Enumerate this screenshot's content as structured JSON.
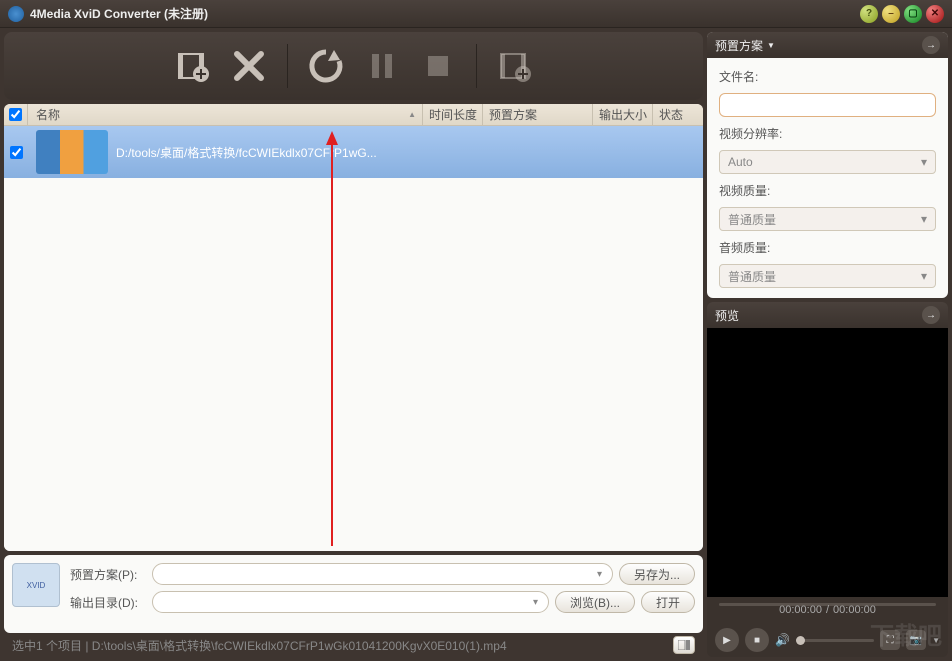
{
  "window": {
    "title": "4Media XviD Converter (未注册)"
  },
  "columns": {
    "name": "名称",
    "duration": "时间长度",
    "profile": "预置方案",
    "output_size": "输出大小",
    "status": "状态"
  },
  "files": [
    {
      "checked": true,
      "path": "D:/tools/桌面/格式转换/fcCWIEkdlx07CFrP1wG..."
    }
  ],
  "bottom": {
    "profile_label": "预置方案(P):",
    "output_label": "输出目录(D):",
    "save_as": "另存为...",
    "browse": "浏览(B)...",
    "open": "打开"
  },
  "status": "选中1 个项目 | D:\\tools\\桌面\\格式转换\\fcCWIEkdlx07CFrP1wGk01041200KgvX0E010(1).mp4",
  "right": {
    "profile_header": "预置方案",
    "filename_label": "文件名:",
    "resolution_label": "视频分辨率:",
    "resolution_value": "Auto",
    "vquality_label": "视频质量:",
    "vquality_value": "普通质量",
    "aquality_label": "音频质量:",
    "aquality_value": "普通质量",
    "preview_header": "预览",
    "time_current": "00:00:00",
    "time_sep": "/",
    "time_total": "00:00:00"
  }
}
